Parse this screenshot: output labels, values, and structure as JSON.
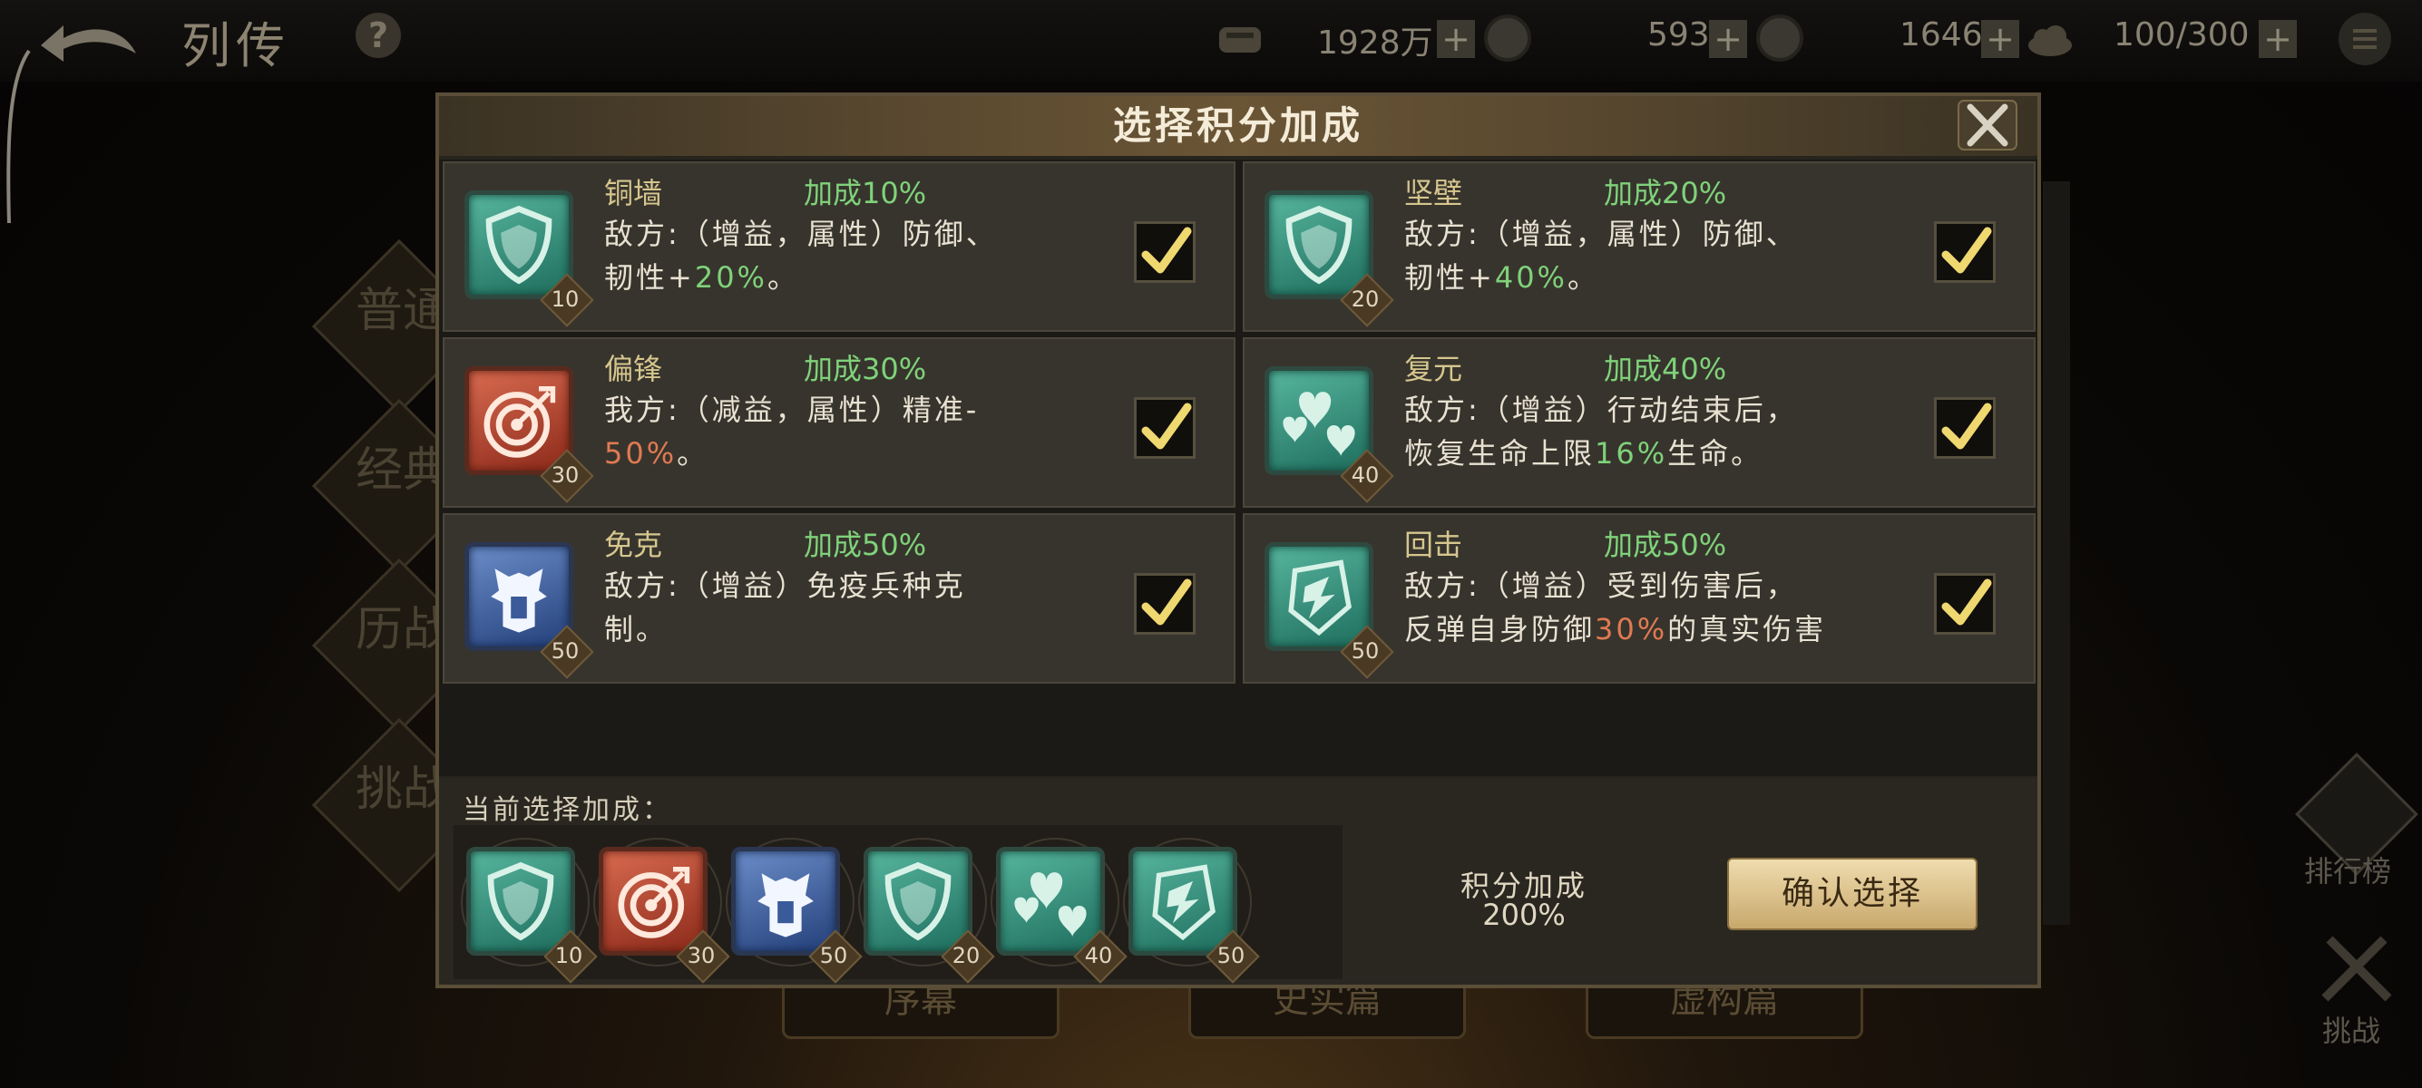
{
  "header": {
    "back_icon": "back-arrow-icon",
    "title": "列传",
    "help_label": "?",
    "resources": [
      {
        "icon": "stamina-icon",
        "value": "1928万"
      },
      {
        "icon": "coin-icon",
        "value": "593"
      },
      {
        "icon": "gem-icon",
        "value": "1646"
      },
      {
        "icon": "cloud-icon",
        "value": "100/300"
      }
    ],
    "plus_label": "+",
    "menu_icon": "menu-list-icon"
  },
  "background": {
    "side_tabs": [
      "普通",
      "经典",
      "历战",
      "挑战"
    ],
    "bottom_tabs": [
      "序幕",
      "史实篇",
      "虚构篇"
    ],
    "right_items": [
      {
        "icon": "rank-shield-icon",
        "label": "排行榜"
      },
      {
        "icon": "swords-icon",
        "label": "挑战"
      }
    ]
  },
  "modal": {
    "title": "选择积分加成",
    "close_icon": "close-x-icon",
    "cards": [
      {
        "name": "铜墙",
        "bonus": "加成10%",
        "icon": "shield-icon",
        "icon_color": "green",
        "cost": "10",
        "desc_parts": [
          "敌方:（增益，属性）防御、",
          "韧性+",
          "20%",
          "。"
        ],
        "highlight": "green",
        "checked": true
      },
      {
        "name": "坚壁",
        "bonus": "加成20%",
        "icon": "shield-icon",
        "icon_color": "green",
        "cost": "20",
        "desc_parts": [
          "敌方:（增益，属性）防御、",
          "韧性+",
          "40%",
          "。"
        ],
        "highlight": "green",
        "checked": true
      },
      {
        "name": "偏锋",
        "bonus": "加成30%",
        "icon": "target-icon",
        "icon_color": "red",
        "cost": "30",
        "desc_parts": [
          "我方:（减益，属性）精准-",
          "",
          "50%",
          "。"
        ],
        "highlight": "red",
        "checked": true
      },
      {
        "name": "复元",
        "bonus": "加成40%",
        "icon": "hearts-icon",
        "icon_color": "green",
        "cost": "40",
        "desc_parts": [
          "敌方:（增益）行动结束后，",
          "恢复生命上限",
          "16%",
          "生命。"
        ],
        "highlight": "green",
        "checked": true
      },
      {
        "name": "免克",
        "bonus": "加成50%",
        "icon": "armor-icon",
        "icon_color": "blue",
        "cost": "50",
        "desc_parts": [
          "敌方:（增益）免疫兵种克",
          "制。",
          "",
          ""
        ],
        "highlight": "",
        "checked": true
      },
      {
        "name": "回击",
        "bonus": "加成50%",
        "icon": "counter-attack-icon",
        "icon_color": "green",
        "cost": "50",
        "desc_parts": [
          "敌方:（增益）受到伤害后，",
          "反弹自身防御",
          "30%",
          "的真实伤害"
        ],
        "highlight": "red",
        "checked": true
      }
    ],
    "selection": {
      "label": "当前选择加成：",
      "items": [
        {
          "icon": "shield-icon",
          "icon_color": "green",
          "cost": "10"
        },
        {
          "icon": "target-icon",
          "icon_color": "red",
          "cost": "30"
        },
        {
          "icon": "armor-icon",
          "icon_color": "blue",
          "cost": "50"
        },
        {
          "icon": "shield-icon",
          "icon_color": "green",
          "cost": "20"
        },
        {
          "icon": "hearts-icon",
          "icon_color": "green",
          "cost": "40"
        },
        {
          "icon": "counter-attack-icon",
          "icon_color": "green",
          "cost": "50"
        }
      ]
    },
    "bonus_label": "积分加成",
    "bonus_value": "200%",
    "confirm_label": "确认选择"
  },
  "colors": {
    "gold_text": "#d6c68e",
    "green_highlight": "#7fd27a",
    "red_highlight": "#e07a52",
    "button_gold": "#e6cf9a"
  }
}
